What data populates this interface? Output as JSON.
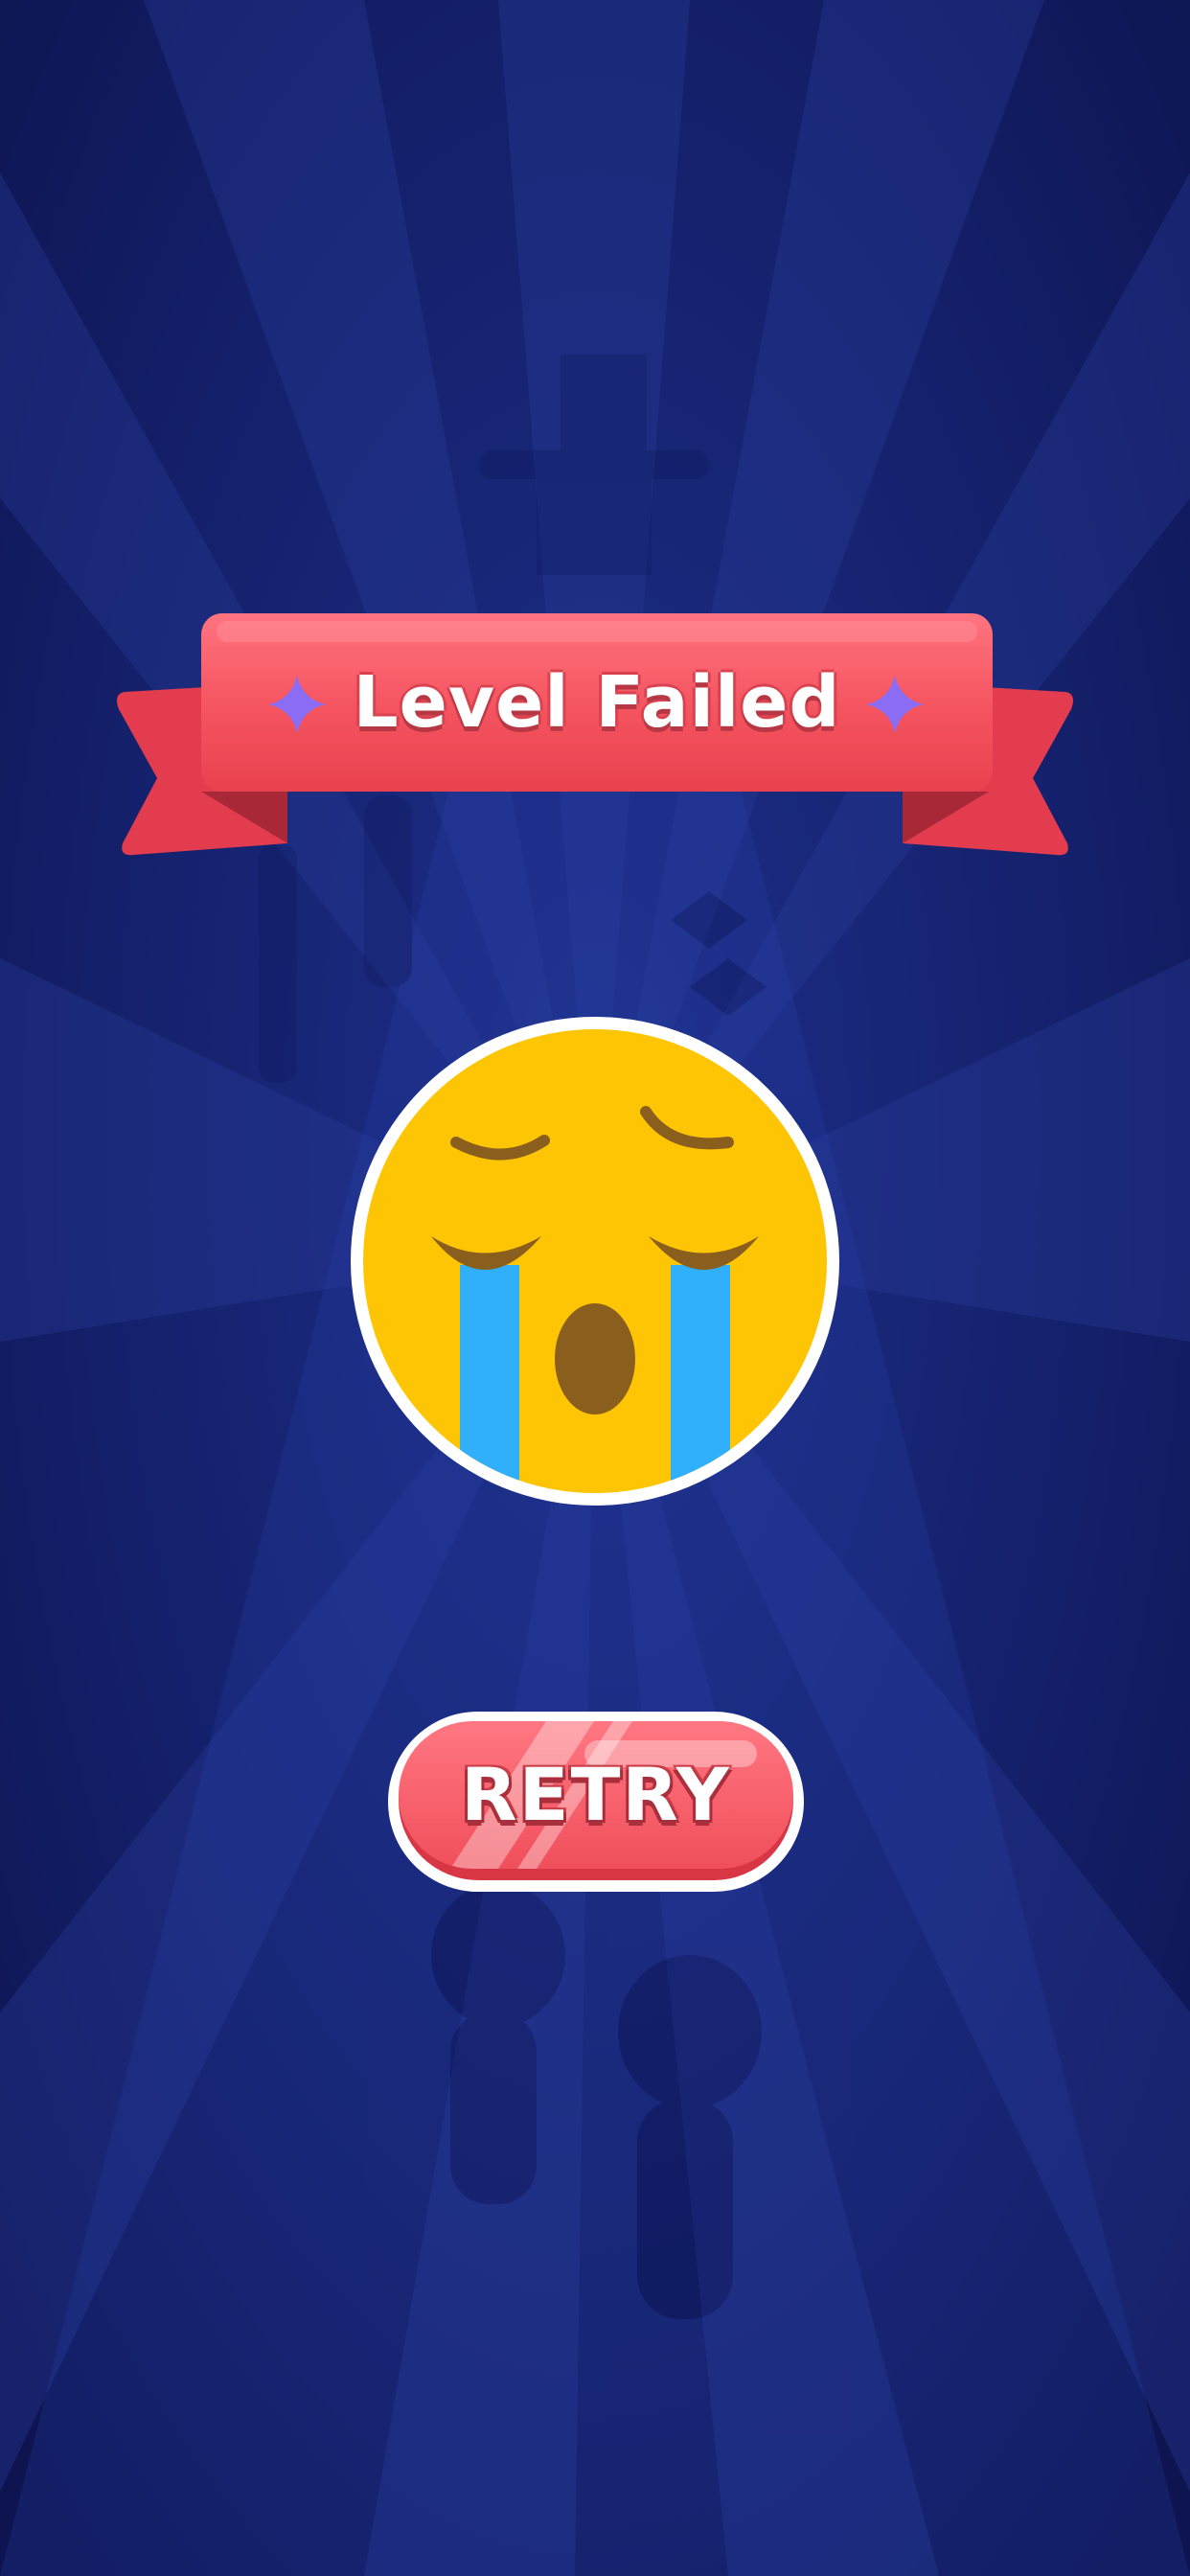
{
  "screen": {
    "name": "level-failed",
    "background_color": "#101a5c",
    "ray_color": "#1a2a80"
  },
  "banner": {
    "title": "Level Failed",
    "ribbon_color": "#f2505d",
    "ribbon_tail_color": "#e23a4c",
    "sparkle_color": "#8a6cf5"
  },
  "emoji": {
    "icon": "loudly-crying-face-icon",
    "face_color": "#fec504",
    "tear_color": "#30b0fb",
    "feature_color": "#8a5f1e",
    "border_color": "#ffffff"
  },
  "retry": {
    "label": "RETRY",
    "button_color": "#f04f5b",
    "border_color": "#ffffff"
  }
}
